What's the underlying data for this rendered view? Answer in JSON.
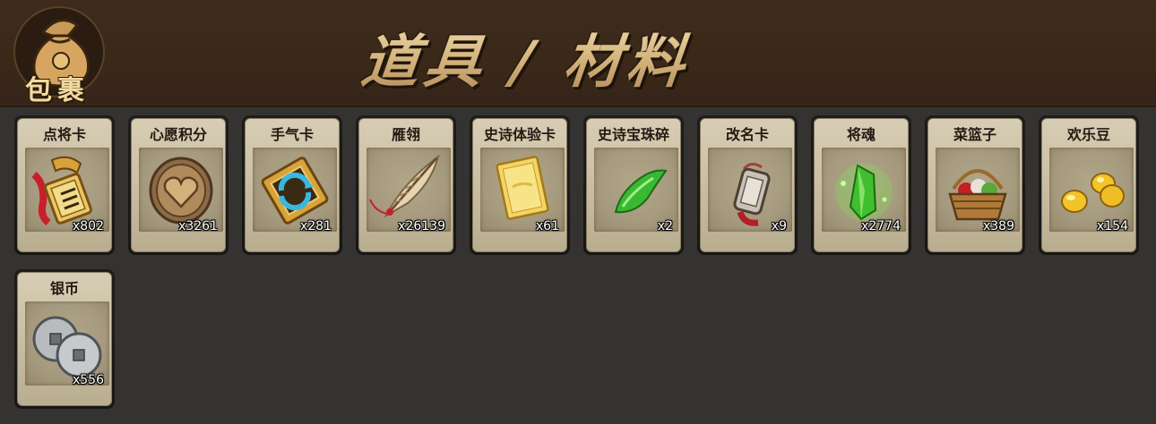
{
  "header": {
    "logo_text": "包裹",
    "title": "道具 / 材料"
  },
  "items": [
    {
      "name": "点将卡",
      "count": "x802",
      "icon": "general-card-token-icon"
    },
    {
      "name": "心愿积分",
      "count": "x3261",
      "icon": "heart-coin-icon"
    },
    {
      "name": "手气卡",
      "count": "x281",
      "icon": "luck-card-icon"
    },
    {
      "name": "雁翎",
      "count": "x26139",
      "icon": "feather-icon"
    },
    {
      "name": "史诗体验卡",
      "count": "x61",
      "icon": "gold-card-icon"
    },
    {
      "name": "史诗宝珠碎",
      "count": "x2",
      "icon": "green-jade-shard-icon"
    },
    {
      "name": "改名卡",
      "count": "x9",
      "icon": "rename-tag-icon"
    },
    {
      "name": "将魂",
      "count": "x2774",
      "icon": "green-crystal-icon"
    },
    {
      "name": "菜篮子",
      "count": "x389",
      "icon": "vegetable-basket-icon"
    },
    {
      "name": "欢乐豆",
      "count": "x154",
      "icon": "gold-beans-icon"
    },
    {
      "name": "银币",
      "count": "x556",
      "icon": "silver-coins-icon"
    }
  ],
  "colors": {
    "header_bg": "#3d2b1b",
    "panel_bg": "#343332",
    "card_bg": "#cbc0a4",
    "title_gold": "#d9bf8c"
  }
}
